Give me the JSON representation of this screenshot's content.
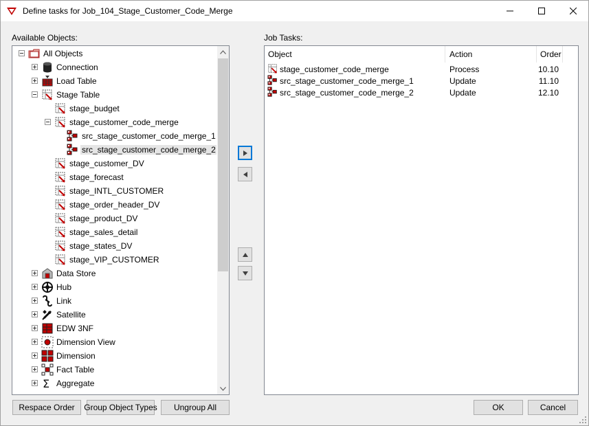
{
  "window": {
    "title": "Define tasks for Job_104_Stage_Customer_Code_Merge"
  },
  "available": {
    "label": "Available Objects:",
    "tree": [
      {
        "label": "All Objects",
        "icon": "folder-icon",
        "expander": "minus",
        "indent": 0
      },
      {
        "label": "Connection",
        "icon": "database-icon",
        "expander": "plus",
        "indent": 1
      },
      {
        "label": "Load Table",
        "icon": "load-table-icon",
        "expander": "plus",
        "indent": 1
      },
      {
        "label": "Stage Table",
        "icon": "stage-table-icon",
        "expander": "minus",
        "indent": 1
      },
      {
        "label": "stage_budget",
        "icon": "stage-table-icon",
        "expander": "none",
        "indent": 2
      },
      {
        "label": "stage_customer_code_merge",
        "icon": "stage-table-icon",
        "expander": "minus",
        "indent": 2
      },
      {
        "label": "src_stage_customer_code_merge_1",
        "icon": "source-mapping-icon",
        "expander": "none",
        "indent": 3
      },
      {
        "label": "src_stage_customer_code_merge_2",
        "icon": "source-mapping-icon",
        "expander": "none",
        "indent": 3,
        "selected": true
      },
      {
        "label": "stage_customer_DV",
        "icon": "stage-table-icon",
        "expander": "none",
        "indent": 2
      },
      {
        "label": "stage_forecast",
        "icon": "stage-table-icon",
        "expander": "none",
        "indent": 2
      },
      {
        "label": "stage_INTL_CUSTOMER",
        "icon": "stage-table-icon",
        "expander": "none",
        "indent": 2
      },
      {
        "label": "stage_order_header_DV",
        "icon": "stage-table-icon",
        "expander": "none",
        "indent": 2
      },
      {
        "label": "stage_product_DV",
        "icon": "stage-table-icon",
        "expander": "none",
        "indent": 2
      },
      {
        "label": "stage_sales_detail",
        "icon": "stage-table-icon",
        "expander": "none",
        "indent": 2
      },
      {
        "label": "stage_states_DV",
        "icon": "stage-table-icon",
        "expander": "none",
        "indent": 2
      },
      {
        "label": "stage_VIP_CUSTOMER",
        "icon": "stage-table-icon",
        "expander": "none",
        "indent": 2
      },
      {
        "label": "Data Store",
        "icon": "data-store-icon",
        "expander": "plus",
        "indent": 1
      },
      {
        "label": "Hub",
        "icon": "hub-icon",
        "expander": "plus",
        "indent": 1
      },
      {
        "label": "Link",
        "icon": "link-icon",
        "expander": "plus",
        "indent": 1
      },
      {
        "label": "Satellite",
        "icon": "satellite-icon",
        "expander": "plus",
        "indent": 1
      },
      {
        "label": "EDW 3NF",
        "icon": "edw-3nf-icon",
        "expander": "plus",
        "indent": 1
      },
      {
        "label": "Dimension View",
        "icon": "dimension-view-icon",
        "expander": "plus",
        "indent": 1
      },
      {
        "label": "Dimension",
        "icon": "dimension-icon",
        "expander": "plus",
        "indent": 1
      },
      {
        "label": "Fact Table",
        "icon": "fact-table-icon",
        "expander": "plus",
        "indent": 1
      },
      {
        "label": "Aggregate",
        "icon": "aggregate-icon",
        "expander": "plus",
        "indent": 1
      }
    ]
  },
  "jobtasks": {
    "label": "Job Tasks:",
    "columns": {
      "object": "Object",
      "action": "Action",
      "order": "Order"
    },
    "rows": [
      {
        "object": "stage_customer_code_merge",
        "action": "Process",
        "order": "10.10",
        "icon": "stage-table-icon"
      },
      {
        "object": "src_stage_customer_code_merge_1",
        "action": "Update",
        "order": "11.10",
        "icon": "source-mapping-icon"
      },
      {
        "object": "src_stage_customer_code_merge_2",
        "action": "Update",
        "order": "12.10",
        "icon": "source-mapping-icon"
      }
    ]
  },
  "buttons": {
    "respace": "Respace Order",
    "group": "Group Object Types",
    "ungroup": "Ungroup All",
    "ok": "OK",
    "cancel": "Cancel"
  },
  "colors": {
    "accent": "#0078d7",
    "icon_red": "#c00000"
  }
}
